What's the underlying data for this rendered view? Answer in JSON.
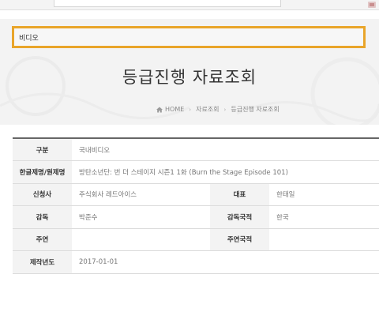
{
  "search": {
    "value": "비디오"
  },
  "page": {
    "title": "등급진행 자료조회"
  },
  "breadcrumb": [
    {
      "label": "HOME"
    },
    {
      "label": "자료조회"
    },
    {
      "label": "등급진행 자료조회"
    }
  ],
  "info": {
    "category": {
      "label": "구분",
      "value": "국내비디오"
    },
    "title": {
      "label": "한글제명/원제명",
      "value": "방탄소년단: 번 더 스테이지 시즌1 1화  (Burn the Stage Episode 101)"
    },
    "applicant": {
      "label": "신청사",
      "value": "주식회사 레드아이스"
    },
    "representative": {
      "label": "대표",
      "value": "한태일"
    },
    "director": {
      "label": "감독",
      "value": "박준수"
    },
    "director_nationality": {
      "label": "감독국적",
      "value": "한국"
    },
    "lead_actor": {
      "label": "주연",
      "value": ""
    },
    "lead_actor_nationality": {
      "label": "주연국적",
      "value": ""
    },
    "production_date": {
      "label": "제작년도",
      "value": "2017-01-01"
    }
  },
  "colors": {
    "accent_border": "#e9a52a",
    "header_bg": "#f3f3f3",
    "table_top_border": "#666666"
  }
}
